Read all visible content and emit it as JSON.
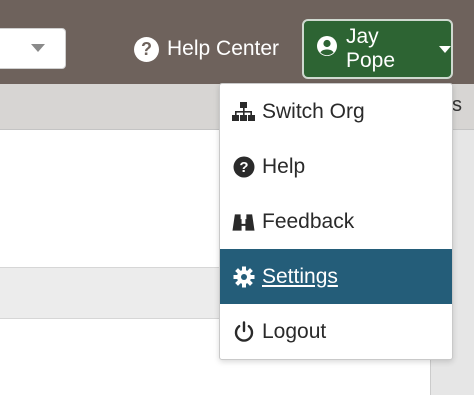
{
  "header": {
    "help_center_label": "Help Center",
    "help_icon": "question-circle-icon",
    "user_name": "Jay Pope",
    "user_icon": "user-circle-icon",
    "bar_color": "#6e625c",
    "user_button_color": "#2d6433"
  },
  "subbar": {
    "partial_label": "s"
  },
  "menu": {
    "active_color": "#245d79",
    "items": [
      {
        "label": "Switch Org",
        "icon": "sitemap-icon"
      },
      {
        "label": "Help",
        "icon": "question-circle-icon"
      },
      {
        "label": "Feedback",
        "icon": "binoculars-icon"
      },
      {
        "label": "Settings",
        "icon": "gear-icon",
        "active": true
      },
      {
        "label": "Logout",
        "icon": "power-icon"
      }
    ]
  }
}
